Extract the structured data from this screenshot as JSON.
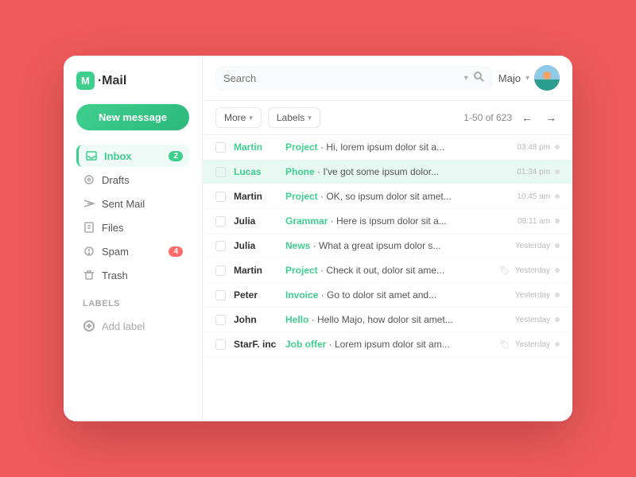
{
  "app": {
    "logo_icon": "M",
    "logo_name": "Mail",
    "logo_dot": "·"
  },
  "sidebar": {
    "new_message_label": "New message",
    "nav_items": [
      {
        "id": "inbox",
        "label": "Inbox",
        "icon": "inbox",
        "badge": "2",
        "active": true
      },
      {
        "id": "drafts",
        "label": "Drafts",
        "icon": "draft",
        "badge": null,
        "active": false
      },
      {
        "id": "sent",
        "label": "Sent Mail",
        "icon": "sent",
        "badge": null,
        "active": false
      },
      {
        "id": "files",
        "label": "Files",
        "icon": "file",
        "badge": null,
        "active": false
      },
      {
        "id": "spam",
        "label": "Spam",
        "icon": "spam",
        "badge": "4",
        "active": false
      },
      {
        "id": "trash",
        "label": "Trash",
        "icon": "trash",
        "badge": null,
        "active": false
      }
    ],
    "labels_title": "Labels",
    "add_label": "Add label"
  },
  "header": {
    "search_placeholder": "Search",
    "user_name": "Majo",
    "user_chevron": "▾"
  },
  "toolbar": {
    "more_label": "More",
    "labels_label": "Labels",
    "pagination": "1-50 of 623"
  },
  "emails": [
    {
      "id": 1,
      "sender": "Martin",
      "sender_green": true,
      "subject_label": "Project",
      "subject_text": " · Hi, lorem ipsum dolor sit a...",
      "time": "03:48 pm",
      "has_tag": false,
      "selected": false,
      "highlighted": false
    },
    {
      "id": 2,
      "sender": "Lucas",
      "sender_green": true,
      "subject_label": "Phone",
      "subject_text": " · I've got some ipsum dolor...",
      "time": "01:34 pm",
      "has_tag": false,
      "selected": false,
      "highlighted": true
    },
    {
      "id": 3,
      "sender": "Martin",
      "sender_green": false,
      "subject_label": "Project",
      "subject_text": " · OK, so ipsum dolor sit amet...",
      "time": "10:45 am",
      "has_tag": false,
      "selected": false,
      "highlighted": false
    },
    {
      "id": 4,
      "sender": "Julia",
      "sender_green": false,
      "subject_label": "Grammar",
      "subject_text": " · Here is ipsum dolor sit a...",
      "time": "08:11 am",
      "has_tag": false,
      "selected": false,
      "highlighted": false
    },
    {
      "id": 5,
      "sender": "Julia",
      "sender_green": false,
      "subject_label": "News",
      "subject_text": " · What a great ipsum dolor s...",
      "time": "Yesterday",
      "has_tag": false,
      "selected": false,
      "highlighted": false
    },
    {
      "id": 6,
      "sender": "Martin",
      "sender_green": false,
      "subject_label": "Project",
      "subject_text": " · Check it out, dolor sit ame...",
      "time": "Yesterday",
      "has_tag": true,
      "selected": false,
      "highlighted": false
    },
    {
      "id": 7,
      "sender": "Peter",
      "sender_green": false,
      "subject_label": "Invoice",
      "subject_text": " · Go to dolor sit amet and...",
      "time": "Yesterday",
      "has_tag": false,
      "selected": false,
      "highlighted": false
    },
    {
      "id": 8,
      "sender": "John",
      "sender_green": false,
      "subject_label": "Hello",
      "subject_text": " · Hello Majo, how dolor sit amet...",
      "time": "Yesterday",
      "has_tag": false,
      "selected": false,
      "highlighted": false
    },
    {
      "id": 9,
      "sender": "StarF. inc",
      "sender_green": false,
      "subject_label": "Job offer",
      "subject_text": " · Lorem ipsum dolor sit am...",
      "time": "Yesterday",
      "has_tag": true,
      "selected": false,
      "highlighted": false
    }
  ]
}
